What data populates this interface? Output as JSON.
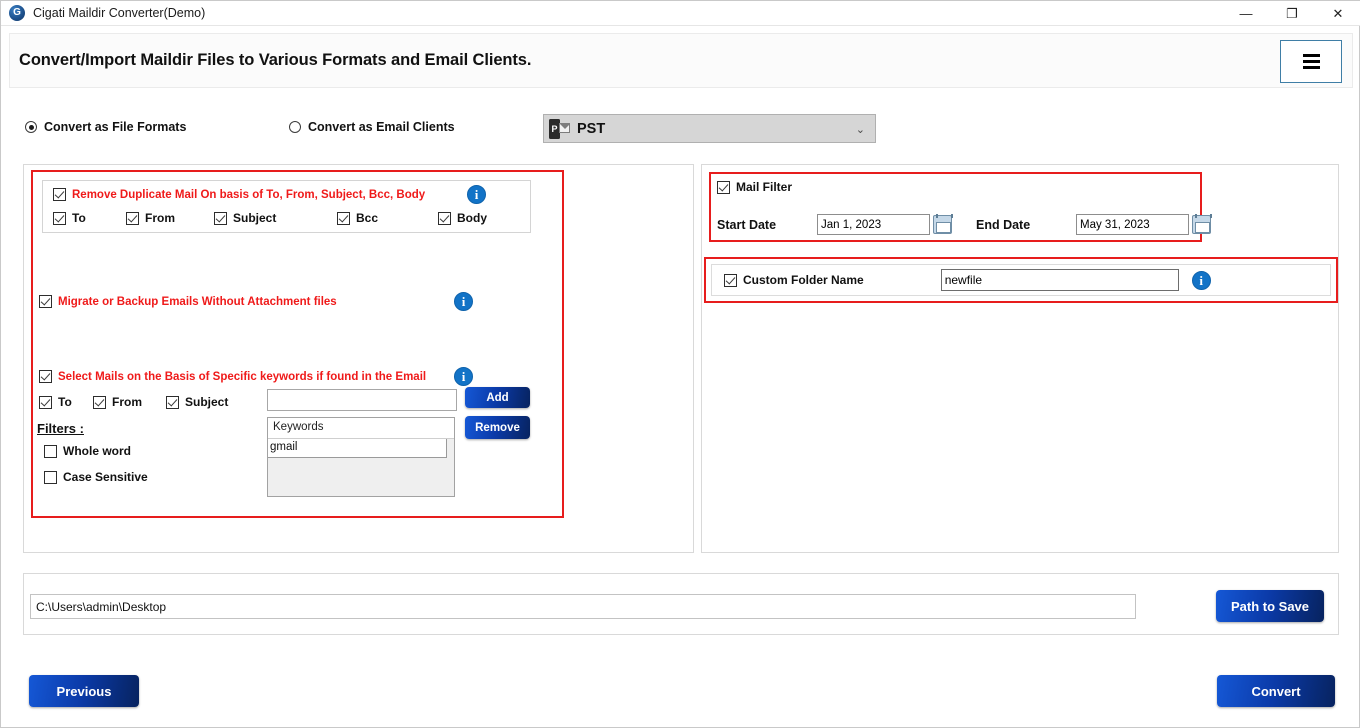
{
  "window": {
    "title": "Cigati Maildir Converter(Demo)",
    "app_icon": "app-logo-icon",
    "minimize": "—",
    "maximize": "❐",
    "close": "✕"
  },
  "header": {
    "title": "Convert/Import Maildir Files to Various Formats and Email Clients.",
    "menu_icon": "hamburger-menu-icon"
  },
  "mode": {
    "file_formats_label": "Convert as File Formats",
    "file_formats_selected": true,
    "email_clients_label": "Convert as Email Clients",
    "email_clients_selected": false,
    "format_select_value": "PST",
    "format_select_icon": "pst-file-icon",
    "format_caret": "⌄"
  },
  "duplicate": {
    "main_label": "Remove Duplicate Mail On basis of To, From, Subject, Bcc, Body",
    "main_checked": true,
    "info_icon": "i",
    "fields": [
      {
        "label": "To",
        "checked": true
      },
      {
        "label": "From",
        "checked": true
      },
      {
        "label": "Subject",
        "checked": true
      },
      {
        "label": "Bcc",
        "checked": true
      },
      {
        "label": "Body",
        "checked": true
      }
    ]
  },
  "migrate": {
    "label": "Migrate or Backup Emails Without Attachment files",
    "checked": true,
    "info_icon": "i"
  },
  "keywords": {
    "main_label": "Select Mails on the Basis of Specific keywords if found in the Email",
    "main_checked": true,
    "info_icon": "i",
    "fields": [
      {
        "label": "To",
        "checked": true
      },
      {
        "label": "From",
        "checked": true
      },
      {
        "label": "Subject",
        "checked": true
      }
    ],
    "input_value": "",
    "input_placeholder": "",
    "add_label": "Add",
    "remove_label": "Remove",
    "list_header": "Keywords",
    "list_items": [
      "gmail"
    ],
    "filters_label": "Filters :",
    "filters": [
      {
        "label": "Whole word",
        "checked": false
      },
      {
        "label": "Case Sensitive",
        "checked": false
      }
    ]
  },
  "mail_filter": {
    "title": "Mail Filter",
    "checked": true,
    "start_date_label": "Start Date",
    "start_date_value": "Jan 1, 2023",
    "end_date_label": "End Date",
    "end_date_value": "May 31, 2023",
    "calendar_icon": "calendar-icon"
  },
  "custom_folder": {
    "label": "Custom Folder Name",
    "checked": true,
    "value": "newfile",
    "info_icon": "i"
  },
  "path": {
    "value": "C:\\Users\\admin\\Desktop",
    "button_label": "Path to Save"
  },
  "footer": {
    "previous_label": "Previous",
    "convert_label": "Convert"
  },
  "colors": {
    "accent_red": "#e71d1d",
    "button_blue": "#0b3aa8",
    "info_blue": "#1273c7"
  }
}
